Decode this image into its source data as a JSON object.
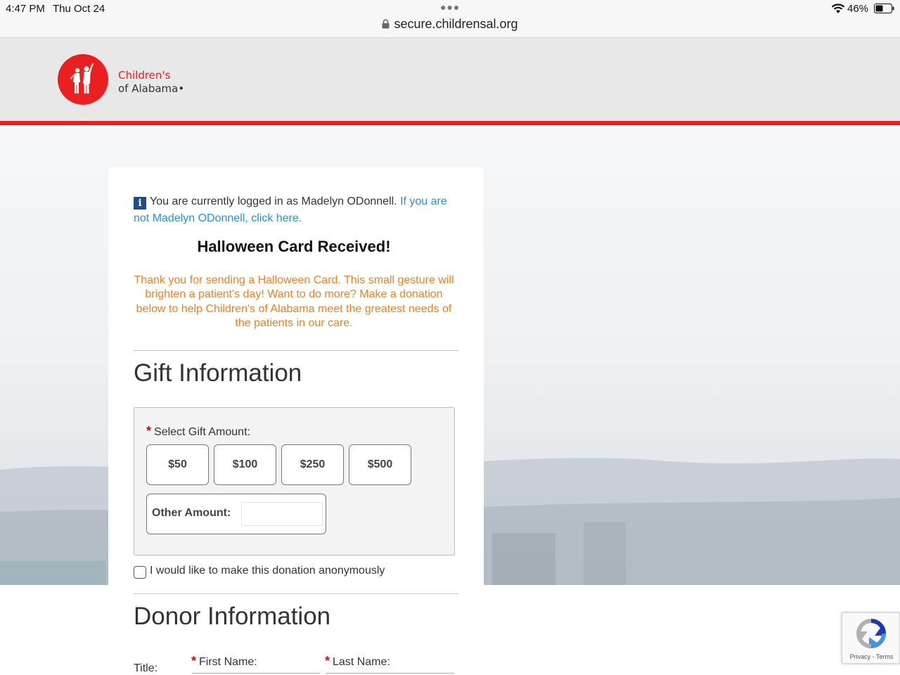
{
  "status_bar": {
    "time": "4:47 PM",
    "date": "Thu Oct 24",
    "battery": "46%",
    "url": "secure.childrensal.org"
  },
  "brand": {
    "line1": "Children's",
    "line2": "of Alabama•",
    "accent_color": "#e9201f"
  },
  "login_note": {
    "text": "You are currently logged in as Madelyn ODonnell. ",
    "link": "If you are not Madelyn ODonnell, click here."
  },
  "confirmation": {
    "title": "Halloween Card Received!",
    "message": "Thank you for sending a Halloween Card. This small gesture will brighten a patient's day! Want to do more? Make a donation below to help Children's of Alabama meet the greatest needs of the patients in our care.",
    "message_color": "#ef7f22"
  },
  "gift": {
    "section_title": "Gift Information",
    "amount_label": "Select Gift Amount:",
    "amounts": [
      "$50",
      "$100",
      "$250",
      "$500"
    ],
    "other_label": "Other Amount:",
    "other_value": "",
    "anonymous_label": "I would like to make this donation anonymously",
    "anonymous_checked": false
  },
  "donor": {
    "section_title": "Donor Information",
    "title_label": "Title:",
    "first_name_label": "First Name:",
    "last_name_label": "Last Name:"
  },
  "recaptcha": {
    "text": "Privacy - Terms"
  }
}
